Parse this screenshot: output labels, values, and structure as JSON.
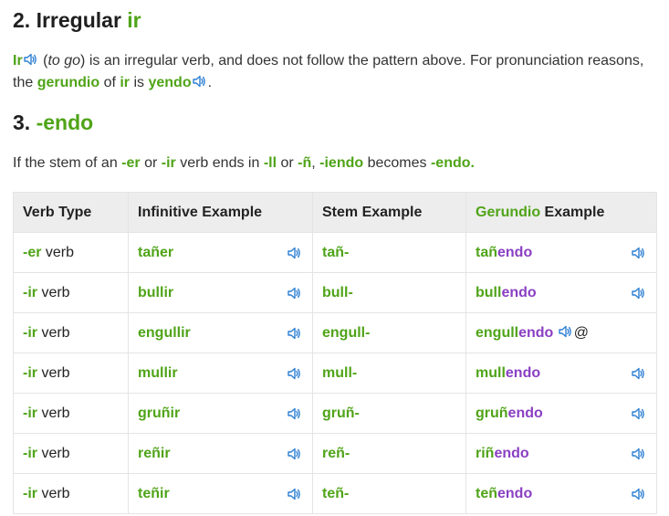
{
  "section2": {
    "number": "2.",
    "title_text": "Irregular",
    "title_green": "ir",
    "para": {
      "ir": "Ir",
      "to_go": "to go",
      "open_paren": " (",
      "close_paren": ")",
      "text1": " is an irregular verb, and does not follow the pattern above. For pronunciation reasons, the ",
      "gerundio": "gerundio",
      "text2": " of ",
      "ir2": "ir",
      "text3": " is ",
      "yendo": "yendo",
      "end": "."
    }
  },
  "section3": {
    "number": "3.",
    "title_green": "-endo",
    "para": {
      "t1": "If the stem of an ",
      "er": "-er",
      "t2": " or ",
      "ir": "-ir",
      "t3": " verb ends in ",
      "ll": "-ll",
      "t4": " or ",
      "n": "-ñ",
      "t5": ", ",
      "iendo": "-iendo",
      "t6": " becomes ",
      "endo": "-endo."
    }
  },
  "table": {
    "headers": {
      "verb_type": "Verb Type",
      "infinitive": "Infinitive Example",
      "stem": "Stem Example",
      "gerundio_green": "Gerundio",
      "gerundio_rest": " Example"
    },
    "rows": [
      {
        "type_suffix": "-er",
        "type_word": " verb",
        "infinitive": "tañer",
        "stem": "tañ-",
        "ger_stem": "tañ",
        "ger_end": "endo",
        "extra": ""
      },
      {
        "type_suffix": "-ir",
        "type_word": " verb",
        "infinitive": "bullir",
        "stem": "bull-",
        "ger_stem": "bull",
        "ger_end": "endo",
        "extra": ""
      },
      {
        "type_suffix": "-ir",
        "type_word": " verb",
        "infinitive": "engullir",
        "stem": "engull-",
        "ger_stem": "engull",
        "ger_end": "endo",
        "extra": "@"
      },
      {
        "type_suffix": "-ir",
        "type_word": " verb",
        "infinitive": "mullir",
        "stem": "mull-",
        "ger_stem": "mull",
        "ger_end": "endo",
        "extra": ""
      },
      {
        "type_suffix": "-ir",
        "type_word": " verb",
        "infinitive": "gruñir",
        "stem": "gruñ-",
        "ger_stem": "gruñ",
        "ger_end": "endo",
        "extra": ""
      },
      {
        "type_suffix": "-ir",
        "type_word": " verb",
        "infinitive": "reñir",
        "stem": "reñ-",
        "ger_stem": "riñ",
        "ger_end": "endo",
        "extra": ""
      },
      {
        "type_suffix": "-ir",
        "type_word": " verb",
        "infinitive": "teñir",
        "stem": "teñ-",
        "ger_stem": "teñ",
        "ger_end": "endo",
        "extra": ""
      }
    ]
  },
  "colors": {
    "green": "#4fa418",
    "purple": "#8a3fc3",
    "speaker_blue": "#2d7fd3"
  },
  "icons": {
    "audio": "speaker-icon"
  }
}
